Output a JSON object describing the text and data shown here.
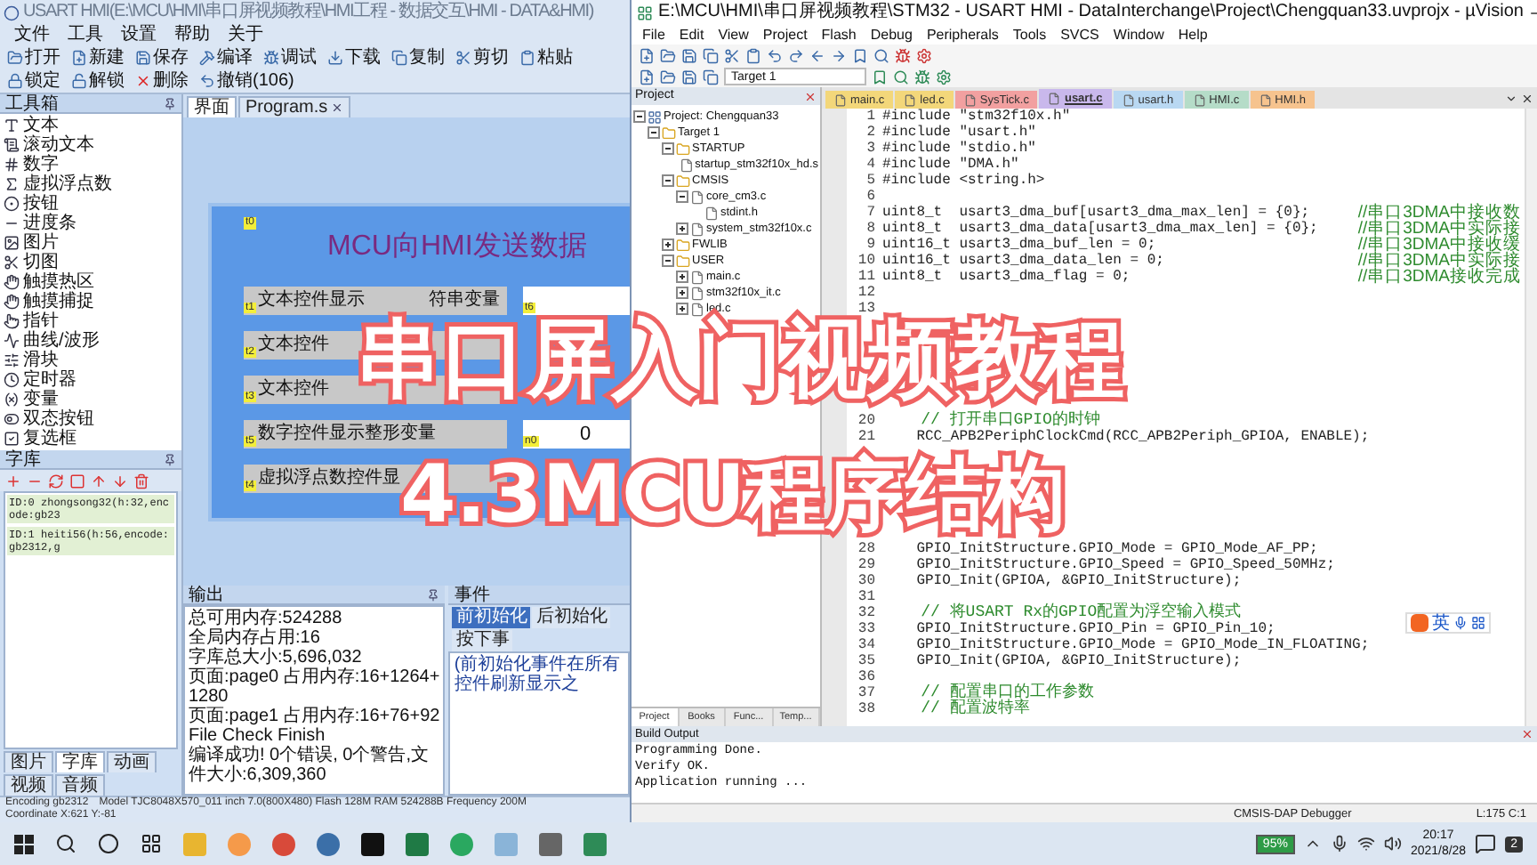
{
  "hmi": {
    "title": "USART HMI(E:\\MCU\\HMI\\串口屏视频教程\\HMI工程 - 数据交互\\HMI - DATA&HMI)",
    "menu": [
      "文件",
      "工具",
      "设置",
      "帮助",
      "关于"
    ],
    "toolbar": [
      "打开",
      "新建",
      "保存",
      "编译",
      "调试",
      "下载",
      "复制",
      "剪切",
      "粘贴",
      "锁定",
      "解锁",
      "删除",
      "撤销(106)"
    ],
    "toolbox": {
      "title": "工具箱",
      "items": [
        "文本",
        "滚动文本",
        "数字",
        "虚拟浮点数",
        "按钮",
        "进度条",
        "图片",
        "切图",
        "触摸热区",
        "触摸捕捉",
        "指针",
        "曲线/波形",
        "滑块",
        "定时器",
        "变量",
        "双态按钮",
        "复选框"
      ]
    },
    "font_panel": {
      "title": "字库",
      "fonts": [
        "ID:0  zhongsong32(h:32,encode:gb23",
        "ID:1  heiti56(h:56,encode:gb2312,g"
      ]
    },
    "left_tabs": [
      {
        "label": "图片",
        "selected": false
      },
      {
        "label": "字库",
        "selected": true
      },
      {
        "label": "动画",
        "selected": false
      },
      {
        "label": "视频",
        "selected": false
      },
      {
        "label": "音频",
        "selected": false
      }
    ],
    "canvas_tabs": [
      {
        "label": "界面",
        "selected": true
      },
      {
        "label": "Program.s",
        "selected": false
      }
    ],
    "page": {
      "tag": "t0",
      "title": "MCU向HMI发送数据",
      "rows": [
        {
          "tag": "t1",
          "parts": [
            "文本控件显示",
            "符串变量"
          ],
          "field": {
            "tag": "t6"
          }
        },
        {
          "tag": "t2",
          "parts": [
            "文本控件"
          ]
        },
        {
          "tag": "t3",
          "parts": [
            "文本控件"
          ]
        },
        {
          "tag": "t5",
          "parts": [
            "数字控件显示整形变量"
          ],
          "field": {
            "tag": "n0",
            "value": "0"
          }
        },
        {
          "tag": "t4",
          "parts": [
            "虚拟浮点数控件显"
          ]
        }
      ]
    },
    "output": {
      "title": "输出",
      "lines": [
        "总可用内存:524288",
        "全局内存占用:16",
        "字库总大小:5,696,032",
        "页面:page0 占用内存:16+1264+1280",
        "页面:page1 占用内存:16+76+92",
        "File Check Finish",
        "编译成功! 0个错误, 0个警告,文件大小:6,309,360"
      ]
    },
    "events": {
      "title": "事件",
      "tabs": [
        {
          "label": "前初始化",
          "selected": true
        },
        {
          "label": "后初始化",
          "selected": false
        },
        {
          "label": "按下事",
          "selected": false
        }
      ],
      "note": "(前初始化事件在所有控件刷新显示之"
    },
    "status_bar": [
      "Encoding gb2312",
      "Model TJC8048X570_011  inch 7.0(800X480)  Flash 128M RAM 524288B Frequency 200M",
      "Coordinate X:621  Y:-81"
    ]
  },
  "keil": {
    "title": "E:\\MCU\\HMI\\串口屏视频教程\\STM32 - USART HMI - DataInterchange\\Project\\Chengquan33.uvprojx - µVision",
    "menu": [
      "File",
      "Edit",
      "View",
      "Project",
      "Flash",
      "Debug",
      "Peripherals",
      "Tools",
      "SVCS",
      "Window",
      "Help"
    ],
    "target": "Target 1",
    "project": {
      "title": "Project",
      "tree": [
        {
          "label": "Project: Chengquan33",
          "kind": "project",
          "expanded": true,
          "children": [
            {
              "label": "Target 1",
              "kind": "folder",
              "expanded": true,
              "children": [
                {
                  "label": "STARTUP",
                  "kind": "folder",
                  "expanded": true,
                  "children": [
                    {
                      "label": "startup_stm32f10x_hd.s",
                      "kind": "file"
                    }
                  ]
                },
                {
                  "label": "CMSIS",
                  "kind": "folder",
                  "expanded": true,
                  "children": [
                    {
                      "label": "core_cm3.c",
                      "kind": "file",
                      "expanded": true,
                      "children": [
                        {
                          "label": "stdint.h",
                          "kind": "file"
                        }
                      ]
                    },
                    {
                      "label": "system_stm32f10x.c",
                      "kind": "file",
                      "expanded": false
                    }
                  ]
                },
                {
                  "label": "FWLIB",
                  "kind": "folder",
                  "expanded": false
                },
                {
                  "label": "USER",
                  "kind": "folder",
                  "expanded": true,
                  "children": [
                    {
                      "label": "main.c",
                      "kind": "file",
                      "expanded": false
                    },
                    {
                      "label": "stm32f10x_it.c",
                      "kind": "file",
                      "expanded": false
                    },
                    {
                      "label": "led.c",
                      "kind": "file",
                      "expanded": false
                    }
                  ]
                }
              ]
            }
          ]
        }
      ],
      "tabs": [
        {
          "label": "Project",
          "selected": true
        },
        {
          "label": "Books",
          "selected": false
        },
        {
          "label": "Func...",
          "selected": false
        },
        {
          "label": "Temp...",
          "selected": false
        }
      ]
    },
    "editor_tabs": [
      {
        "label": "main.c",
        "color": "#f3d77a",
        "selected": false
      },
      {
        "label": "led.c",
        "color": "#f3d77a",
        "selected": false
      },
      {
        "label": "SysTick.c",
        "color": "#f2a0a0",
        "selected": false
      },
      {
        "label": "usart.c",
        "color": "#c9b8ec",
        "selected": true
      },
      {
        "label": "usart.h",
        "color": "#b9d8f2",
        "selected": false
      },
      {
        "label": "HMI.c",
        "color": "#b5dcc8",
        "selected": false
      },
      {
        "label": "HMI.h",
        "color": "#f6c38e",
        "selected": false
      }
    ],
    "code_top": [
      {
        "num": "1",
        "kind": "code",
        "text": "#include \"stm32f10x.h\""
      },
      {
        "num": "2",
        "kind": "code",
        "text": "#include \"usart.h\""
      },
      {
        "num": "3",
        "kind": "code",
        "text": "#include \"stdio.h\""
      },
      {
        "num": "4",
        "kind": "code",
        "text": "#include \"DMA.h\""
      },
      {
        "num": "5",
        "kind": "code",
        "text": "#include <string.h>"
      },
      {
        "num": "6"
      },
      {
        "num": "7",
        "kind": "code",
        "text": "uint8_t  usart3_dma_buf[usart3_dma_max_len] = {0};",
        "comment": "//串口3DMA中接收数"
      },
      {
        "num": "8",
        "kind": "code",
        "text": "uint8_t  usart3_dma_data[usart3_dma_max_len] = {0};",
        "comment": "//串口3DMA中实际接"
      },
      {
        "num": "9",
        "kind": "code",
        "text": "uint16_t usart3_dma_buf_len = 0;",
        "comment": "//串口3DMA中接收缓"
      },
      {
        "num": "10",
        "kind": "code",
        "text": "uint16_t usart3_dma_data_len = 0;",
        "comment": "//串口3DMA中实际接"
      },
      {
        "num": "11",
        "kind": "code",
        "text": "uint8_t  usart3_dma_flag = 0;",
        "comment": "//串口3DMA接收完成"
      },
      {
        "num": "12"
      },
      {
        "num": "13"
      }
    ],
    "code_mid": [
      {
        "num": "20",
        "kind": "comment",
        "text": "    // 打开串口GPIO的时钟"
      },
      {
        "num": "21",
        "kind": "code",
        "text": "    RCC_APB2PeriphClockCmd(RCC_APB2Periph_GPIOA, ENABLE);"
      }
    ],
    "code_bottom": [
      {
        "num": "28",
        "kind": "code",
        "text": "    GPIO_InitStructure.GPIO_Mode = GPIO_Mode_AF_PP;"
      },
      {
        "num": "29",
        "kind": "code",
        "text": "    GPIO_InitStructure.GPIO_Speed = GPIO_Speed_50MHz;"
      },
      {
        "num": "30",
        "kind": "code",
        "text": "    GPIO_Init(GPIOA, &GPIO_InitStructure);"
      },
      {
        "num": "31"
      },
      {
        "num": "32",
        "kind": "comment",
        "text": "    // 将USART Rx的GPIO配置为浮空输入模式"
      },
      {
        "num": "33",
        "kind": "code",
        "text": "    GPIO_InitStructure.GPIO_Pin = GPIO_Pin_10;"
      },
      {
        "num": "34",
        "kind": "code",
        "text": "    GPIO_InitStructure.GPIO_Mode = GPIO_Mode_IN_FLOATING;"
      },
      {
        "num": "35",
        "kind": "code",
        "text": "    GPIO_Init(GPIOA, &GPIO_InitStructure);"
      },
      {
        "num": "36"
      },
      {
        "num": "37",
        "kind": "comment",
        "text": "    // 配置串口的工作参数"
      },
      {
        "num": "38",
        "kind": "comment",
        "text": "    // 配置波特率"
      }
    ],
    "ime": {
      "mode": "英"
    },
    "build_output": {
      "title": "Build Output",
      "lines": [
        "Programming Done.",
        "Verify OK.",
        "Application running ..."
      ]
    },
    "status_bar": {
      "debugger": "CMSIS-DAP Debugger",
      "position": "L:175 C:1"
    }
  },
  "overlay": {
    "line1": "串口屏入门视频教程",
    "line2": "4.3MCU程序结构"
  },
  "taskbar": {
    "battery": "95%",
    "time": "20:17",
    "date": "2021/8/28",
    "notifications": "2"
  }
}
